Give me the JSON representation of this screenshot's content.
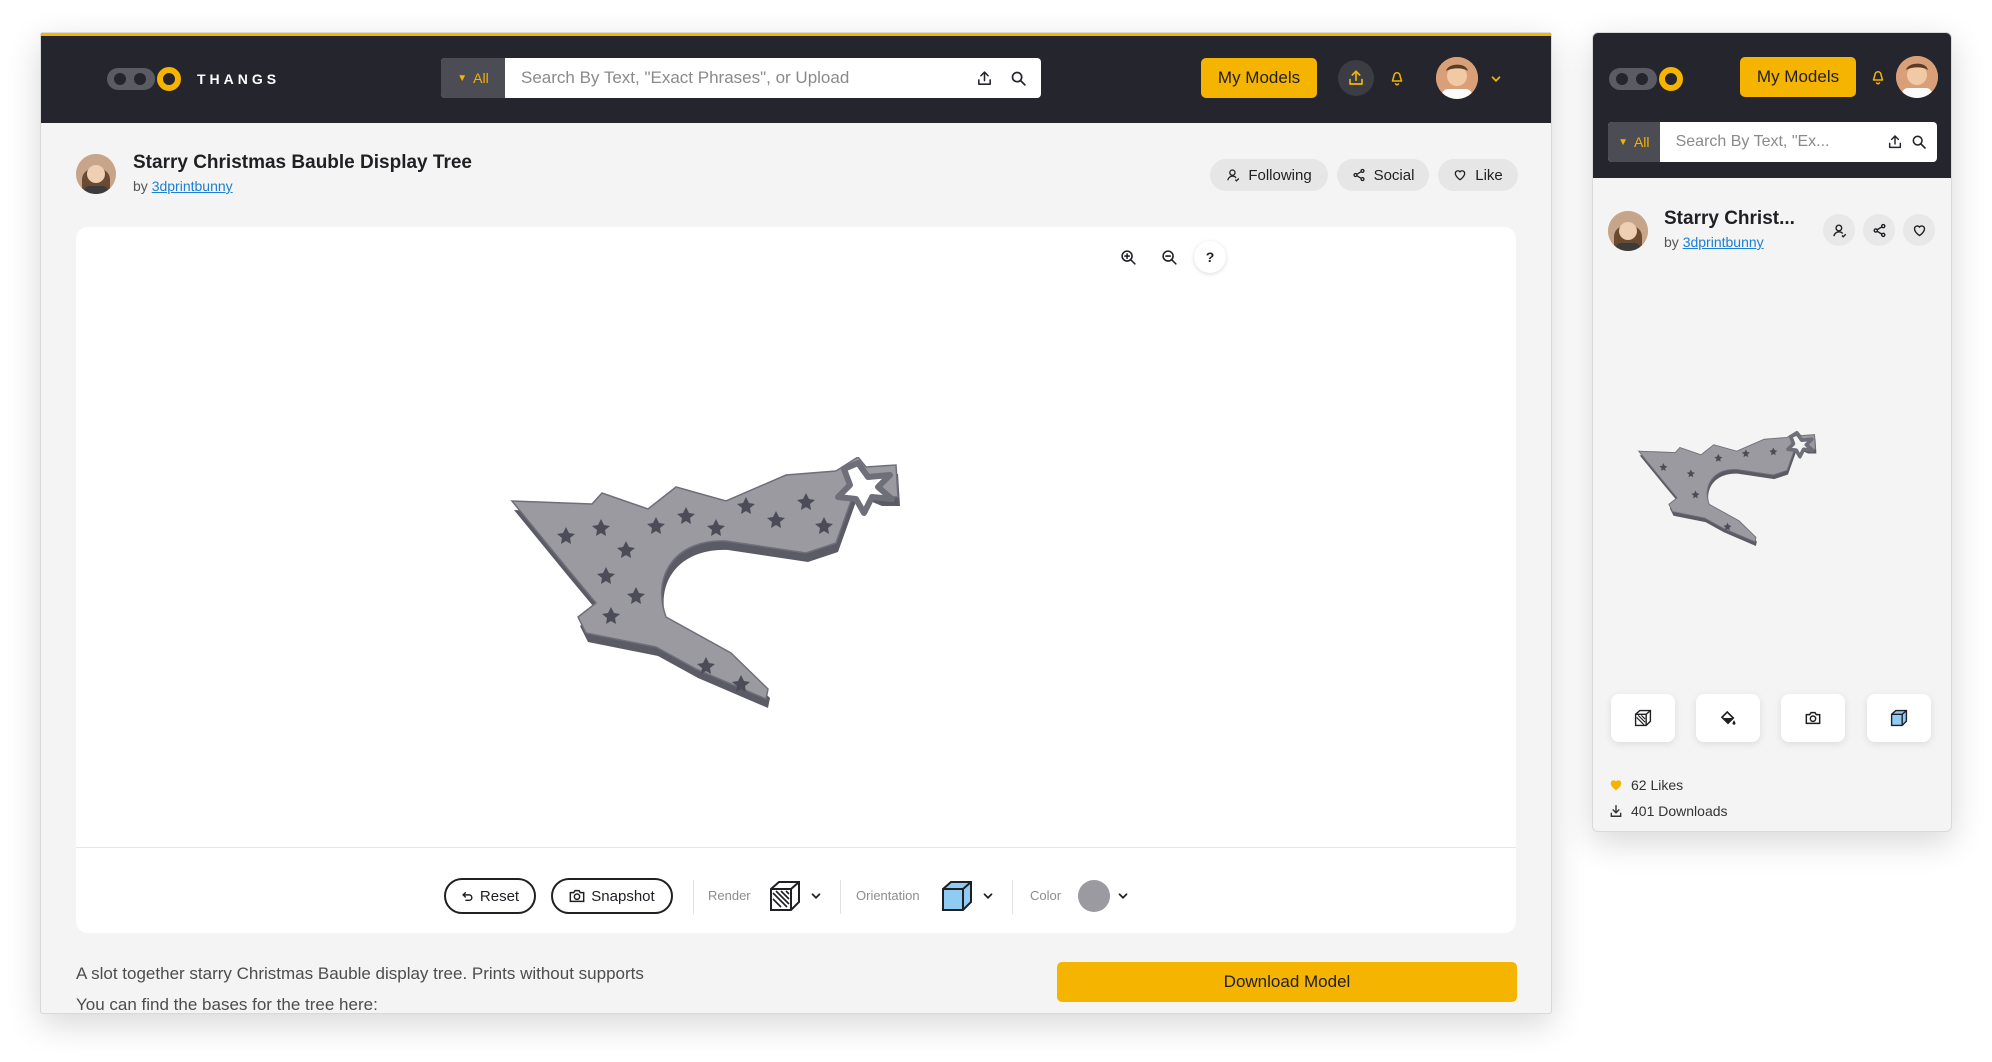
{
  "brand": {
    "name": "THANGS",
    "accent": "#f5b400",
    "nav_bg": "#24252d",
    "link": "#1a7fd6"
  },
  "search": {
    "scope": "All",
    "placeholder": "Search By Text, \"Exact Phrases\", or Upload"
  },
  "mobile_search": {
    "scope": "All",
    "placeholder": "Search By Text, \"Ex..."
  },
  "nav": {
    "my_models": "My Models"
  },
  "model": {
    "title": "Starry Christmas Bauble Display Tree",
    "title_short": "Starry Christ...",
    "by": "by",
    "author": "3dprintbunny"
  },
  "actions": {
    "following": "Following",
    "social": "Social",
    "like": "Like"
  },
  "viewer": {
    "help": "?",
    "reset": "Reset",
    "snapshot": "Snapshot",
    "render_label": "Render",
    "orientation_label": "Orientation",
    "color_label": "Color",
    "model_color": "#9a9aa0"
  },
  "description": {
    "line1": "A slot together starry Christmas Bauble display tree. Prints without supports",
    "line2": "You can find the bases for the tree here:"
  },
  "download": "Download Model",
  "stats": {
    "likes": "62 Likes",
    "downloads": "401 Downloads"
  },
  "icons": [
    "search-icon",
    "upload-icon",
    "bell-icon",
    "chevron-down-icon",
    "user-icon",
    "share-icon",
    "heart-icon",
    "zoom-in-icon",
    "zoom-out-icon",
    "reset-icon",
    "camera-icon",
    "render-cube-icon",
    "orientation-cube-icon",
    "paint-bucket-icon",
    "download-icon"
  ]
}
